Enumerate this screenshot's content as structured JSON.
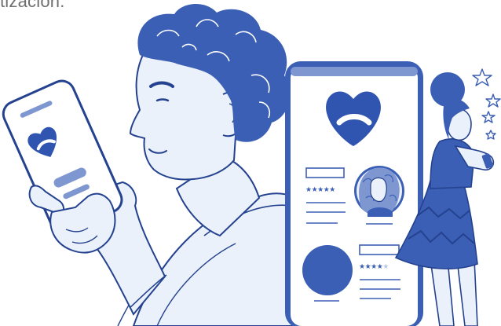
{
  "page": {
    "intro_text": "tización."
  },
  "profile_cards": [
    {
      "rating_stars": "★★★★★",
      "rating": 5,
      "max": 5
    },
    {
      "rating_stars_filled": "★★★★",
      "rating_stars_empty": "★",
      "rating": 4,
      "max": 5
    }
  ],
  "colors": {
    "brand_blue": "#3b5fb5",
    "light_blue": "#eaf1fa",
    "outline": "#24428f",
    "screen_bg": "#ffffff",
    "muted_blue": "#7e97d1"
  },
  "icons": {
    "app_logo": "heart-swirl-icon",
    "stars": "sparkle-stars-icon"
  }
}
